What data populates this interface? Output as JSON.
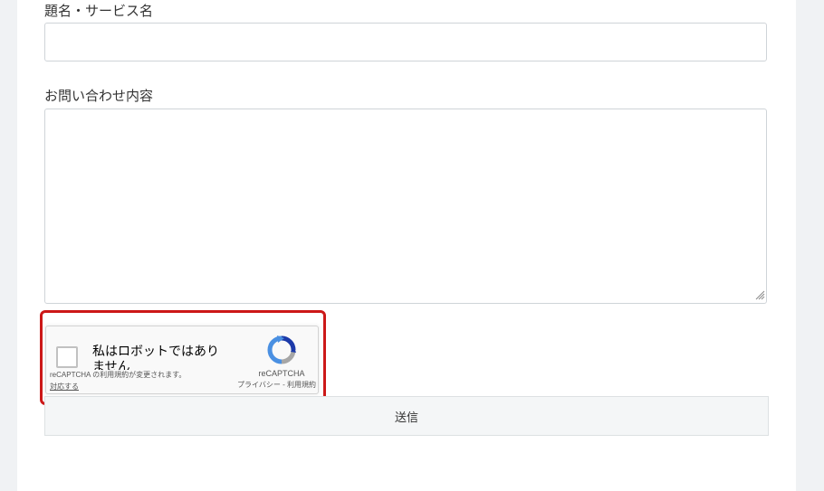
{
  "form": {
    "subject_label": "題名・サービス名",
    "subject_value": "",
    "message_label": "お問い合わせ内容",
    "message_value": "",
    "submit_label": "送信"
  },
  "recaptcha": {
    "checkbox_label": "私はロボットではありません",
    "notice_text": "reCAPTCHA の利用規約が変更されます。",
    "notice_link": "対応する",
    "brand": "reCAPTCHA",
    "terms": "プライバシー - 利用規約",
    "checked": false
  },
  "colors": {
    "highlight": "#cc1818",
    "page_background": "#f0f2f4",
    "recaptcha_blue": "#4a90e2",
    "recaptcha_gray": "#a6a6a6"
  }
}
